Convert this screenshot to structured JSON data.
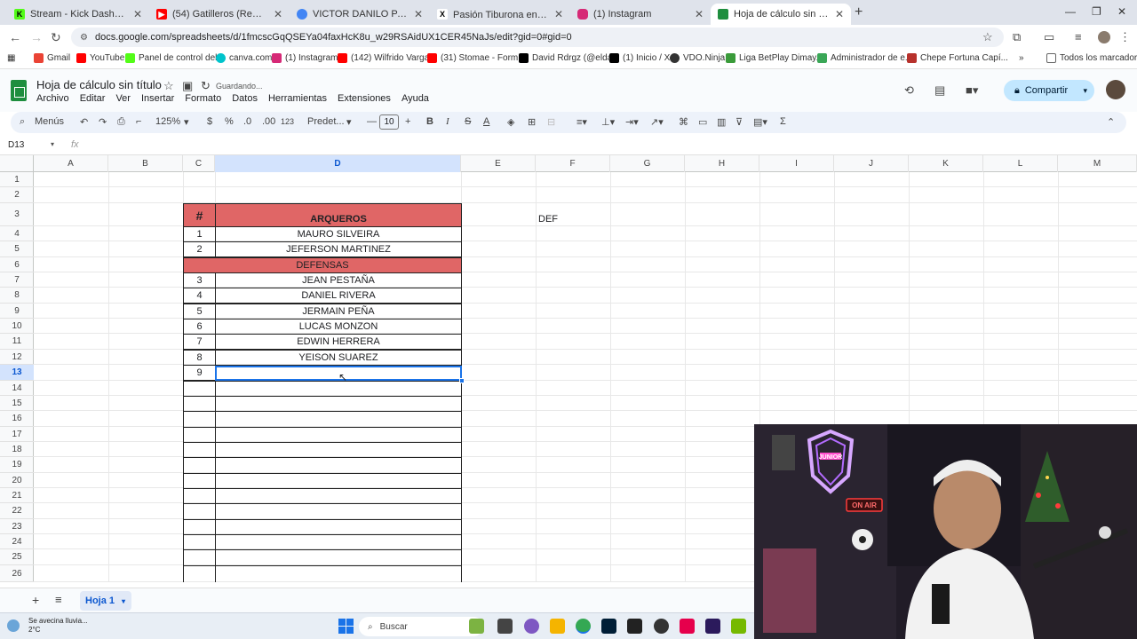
{
  "browser": {
    "tabs": [
      {
        "label": "Stream - Kick Dashboard",
        "color": "#53fc18"
      },
      {
        "label": "(54) Gatilleros (Remix) -Tito El B",
        "color": "#ff0000"
      },
      {
        "label": "VICTOR DANILO PACHECO - Bu",
        "color": "#4285f4"
      },
      {
        "label": "Pasión Tiburona en X: \"👉Juni",
        "color": "#000000"
      },
      {
        "label": "(1) Instagram",
        "color": "#d62976"
      },
      {
        "label": "Hoja de cálculo sin título - Hoja",
        "color": "#1e8e3e"
      }
    ],
    "new_tab": "+",
    "url": "docs.google.com/spreadsheets/d/1fmcscGqQSEYa04faxHcK8u_w29RSAidUX1CER45NaJs/edit?gid=0#gid=0",
    "bookmarks": [
      {
        "label": "Gmail",
        "color": "#ea4335"
      },
      {
        "label": "YouTube",
        "color": "#ff0000"
      },
      {
        "label": "Panel de control del...",
        "color": "#53fc18"
      },
      {
        "label": "canva.com",
        "color": "#00c4cc"
      },
      {
        "label": "(1) Instagram",
        "color": "#d62976"
      },
      {
        "label": "(142) Wilfrido Varga...",
        "color": "#ff0000"
      },
      {
        "label": "(31) Stomae - Form...",
        "color": "#ff0000"
      },
      {
        "label": "David Rdrgz (@elda...",
        "color": "#000000"
      },
      {
        "label": "(1) Inicio / X",
        "color": "#000000"
      },
      {
        "label": "VDO.Ninja",
        "color": "#333333"
      },
      {
        "label": "Liga BetPlay Dimay...",
        "color": "#3a9b3a"
      },
      {
        "label": "Administrador de e...",
        "color": "#3aa757"
      },
      {
        "label": "Chepe Fortuna Capí...",
        "color": "#b7312c"
      }
    ],
    "all_bookmarks": "Todos los marcadores"
  },
  "sheets": {
    "title": "Hoja de cálculo sin título",
    "saving": "Guardando...",
    "menu": [
      "Archivo",
      "Editar",
      "Ver",
      "Insertar",
      "Formato",
      "Datos",
      "Herramientas",
      "Extensiones",
      "Ayuda"
    ],
    "share": "Compartir",
    "toolbar": {
      "menus": "Menús",
      "zoom": "125%",
      "currency": "$",
      "percent": "%",
      "dec_less": ".0",
      "dec_more": ".00",
      "number_fmt": "123",
      "font": "Predet...",
      "font_size": "10",
      "bold": "B",
      "italic": "I",
      "strike": "S",
      "text_color": "A"
    },
    "name_box": "D13",
    "fx": "fx",
    "columns": [
      "A",
      "B",
      "C",
      "D",
      "E",
      "F",
      "G",
      "H",
      "I",
      "J",
      "K",
      "L",
      "M"
    ],
    "rows": [
      "1",
      "2",
      "3",
      "4",
      "5",
      "6",
      "7",
      "8",
      "9",
      "10",
      "11",
      "12",
      "13",
      "14",
      "15",
      "16",
      "17",
      "18",
      "19",
      "20",
      "21",
      "22",
      "23",
      "24",
      "25",
      "26"
    ],
    "table": {
      "hash": "#",
      "header": "ARQUEROS",
      "def_label": "DEF",
      "section": "DEFENSAS",
      "arqueros": [
        {
          "num": "1",
          "name": "MAURO SILVEIRA"
        },
        {
          "num": "2",
          "name": "JEFERSON MARTINEZ"
        }
      ],
      "defensas": [
        {
          "num": "3",
          "name": "JEAN PESTAÑA"
        },
        {
          "num": "4",
          "name": "DANIEL RIVERA"
        },
        {
          "num": "5",
          "name": "JERMAIN PEÑA"
        },
        {
          "num": "6",
          "name": "LUCAS MONZON"
        },
        {
          "num": "7",
          "name": "EDWIN HERRERA"
        },
        {
          "num": "8",
          "name": "YEISON SUAREZ"
        },
        {
          "num": "9",
          "name": ""
        }
      ]
    },
    "sheet_tab": "Hoja 1",
    "header_color": "#e06666"
  },
  "taskbar": {
    "weather_title": "Se avecina lluvia...",
    "weather_temp": "2°C",
    "search": "Buscar"
  },
  "webcam": {
    "sign": "JUNIOR",
    "on_air": "ON AIR"
  }
}
